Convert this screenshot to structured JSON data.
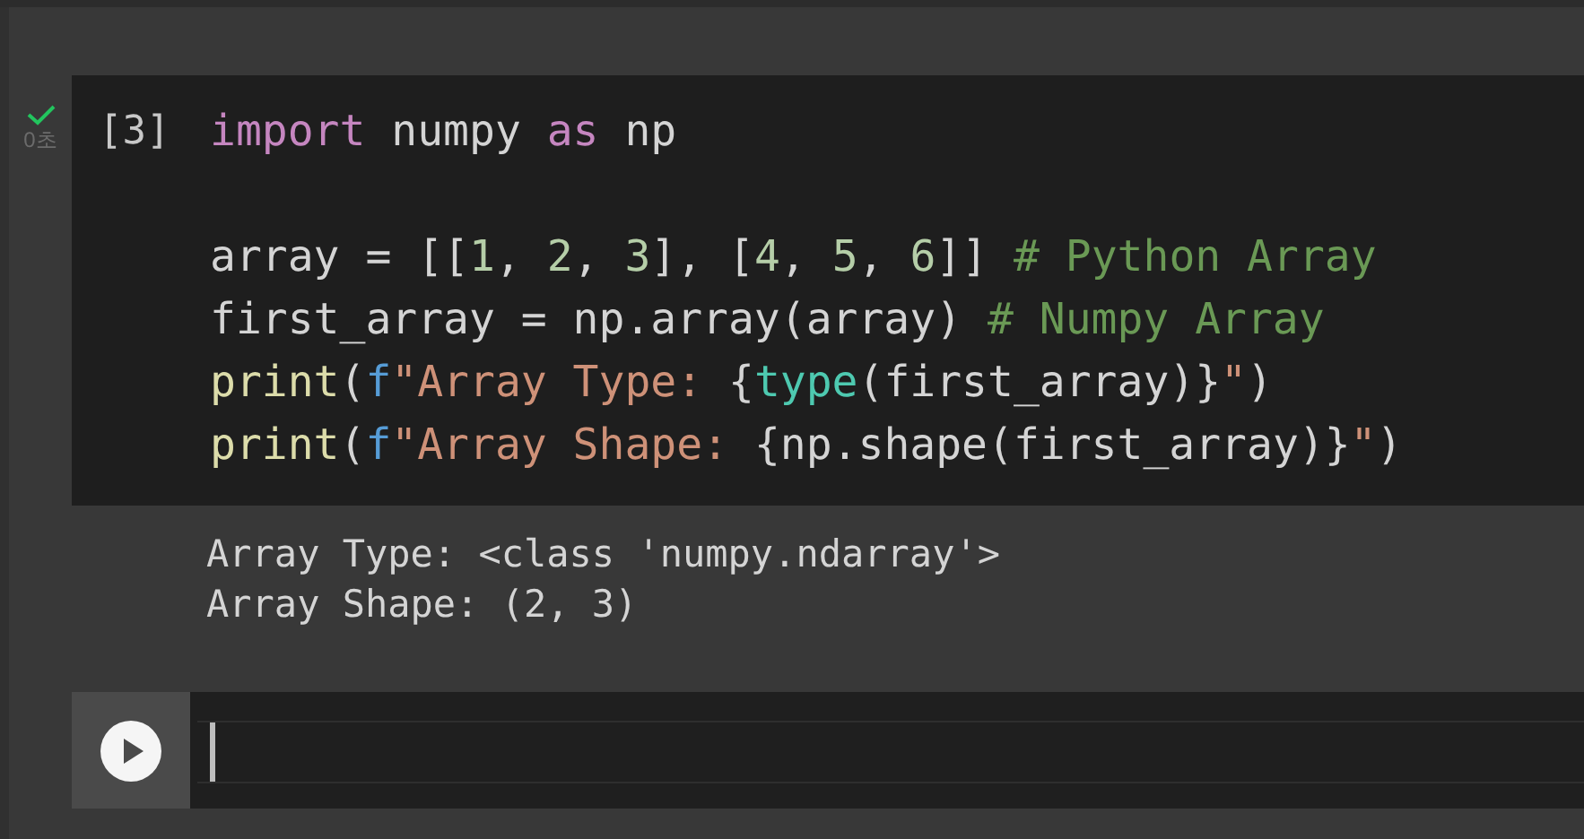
{
  "cells": [
    {
      "ran": true,
      "execution_count": "[3]",
      "elapsed": "0초",
      "lines": [
        {
          "kind": "code",
          "tokens": [
            {
              "kind": "keyword",
              "text": "import"
            },
            {
              "kind": "plain",
              "text": " numpy "
            },
            {
              "kind": "keyword",
              "text": "as"
            },
            {
              "kind": "plain",
              "text": " np"
            }
          ]
        },
        {
          "kind": "blank"
        },
        {
          "kind": "code",
          "tokens": [
            {
              "kind": "plain",
              "text": "array = [["
            },
            {
              "kind": "number",
              "text": "1"
            },
            {
              "kind": "plain",
              "text": ", "
            },
            {
              "kind": "number",
              "text": "2"
            },
            {
              "kind": "plain",
              "text": ", "
            },
            {
              "kind": "number",
              "text": "3"
            },
            {
              "kind": "plain",
              "text": "], ["
            },
            {
              "kind": "number",
              "text": "4"
            },
            {
              "kind": "plain",
              "text": ", "
            },
            {
              "kind": "number",
              "text": "5"
            },
            {
              "kind": "plain",
              "text": ", "
            },
            {
              "kind": "number",
              "text": "6"
            },
            {
              "kind": "plain",
              "text": "]] "
            },
            {
              "kind": "comment",
              "text": "# Python Array"
            }
          ]
        },
        {
          "kind": "code",
          "tokens": [
            {
              "kind": "plain",
              "text": "first_array = np.array(array) "
            },
            {
              "kind": "comment",
              "text": "# Numpy Array"
            }
          ]
        },
        {
          "kind": "code",
          "tokens": [
            {
              "kind": "function",
              "text": "print"
            },
            {
              "kind": "plain",
              "text": "("
            },
            {
              "kind": "fprefix",
              "text": "f"
            },
            {
              "kind": "string",
              "text": "\"Array Type: "
            },
            {
              "kind": "plain",
              "text": "{"
            },
            {
              "kind": "builtin",
              "text": "type"
            },
            {
              "kind": "plain",
              "text": "(first_array)}"
            },
            {
              "kind": "string",
              "text": "\""
            },
            {
              "kind": "plain",
              "text": ")"
            }
          ]
        },
        {
          "kind": "code",
          "tokens": [
            {
              "kind": "function",
              "text": "print"
            },
            {
              "kind": "plain",
              "text": "("
            },
            {
              "kind": "fprefix",
              "text": "f"
            },
            {
              "kind": "string",
              "text": "\"Array Shape: "
            },
            {
              "kind": "plain",
              "text": "{np.shape(first_array)}"
            },
            {
              "kind": "string",
              "text": "\""
            },
            {
              "kind": "plain",
              "text": ")"
            }
          ]
        }
      ],
      "output": [
        "Array Type: <class 'numpy.ndarray'>",
        "Array Shape: (2, 3)"
      ]
    }
  ],
  "new_cell": {
    "focused": true
  }
}
